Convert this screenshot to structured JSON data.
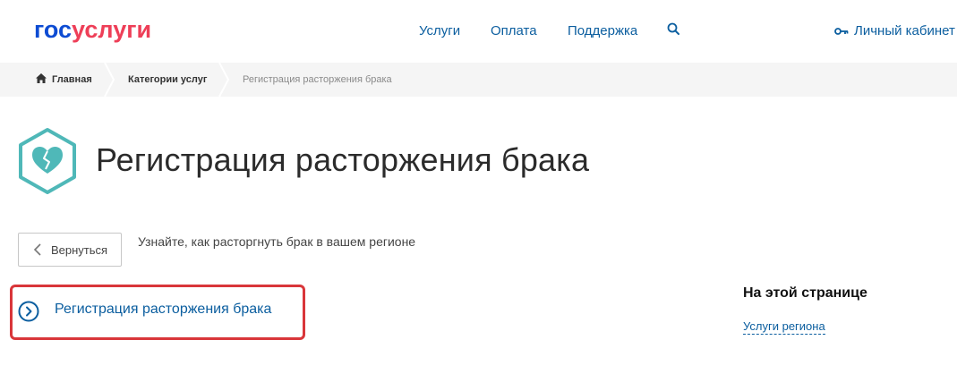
{
  "header": {
    "logo_part1": "гос",
    "logo_part2": "услуги",
    "nav": [
      {
        "label": "Услуги"
      },
      {
        "label": "Оплата"
      },
      {
        "label": "Поддержка"
      }
    ],
    "search_icon": "search-icon",
    "cabinet_label": "Личный кабинет",
    "cabinet_icon": "key-icon"
  },
  "breadcrumb": {
    "home_label": "Главная",
    "categories_label": "Категории услуг",
    "current_label": "Регистрация расторжения брака"
  },
  "page": {
    "title": "Регистрация расторжения брака",
    "badge_icon": "broken-heart-icon",
    "back_label": "Вернуться",
    "description": "Узнайте, как расторгнуть брак в вашем регионе",
    "main_link": "Регистрация расторжения брака"
  },
  "sidebar": {
    "title": "На этой странице",
    "region_link": "Услуги региона"
  },
  "colors": {
    "brand_blue": "#0d4cd3",
    "brand_red": "#ee3f58",
    "link": "#0b5e9f",
    "highlight": "#d9363a",
    "badge": "#4fb8b8"
  }
}
